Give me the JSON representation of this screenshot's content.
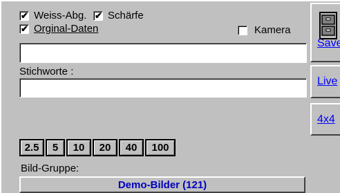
{
  "options": {
    "weiss_abg": {
      "label": "Weiss-Abg.",
      "checked": true
    },
    "schaerfe": {
      "label": "Schärfe",
      "checked": true
    },
    "original_daten": {
      "label": "Orginal-Daten",
      "checked": true
    },
    "kamera": {
      "label": "Kamera",
      "checked": false
    }
  },
  "fields": {
    "name_value": "",
    "stichworte_label": "Stichworte :",
    "stichworte_value": ""
  },
  "zoom": {
    "levels": [
      "2.5",
      "5",
      "10",
      "20",
      "40",
      "100"
    ]
  },
  "group": {
    "label": "Bild-Gruppe:",
    "button": "Demo-Bilder (121)"
  },
  "side": {
    "save": "Save",
    "save_icon": "file-cabinet-icon",
    "live": "Live",
    "grid": "4x4"
  },
  "check_glyph": "✔"
}
